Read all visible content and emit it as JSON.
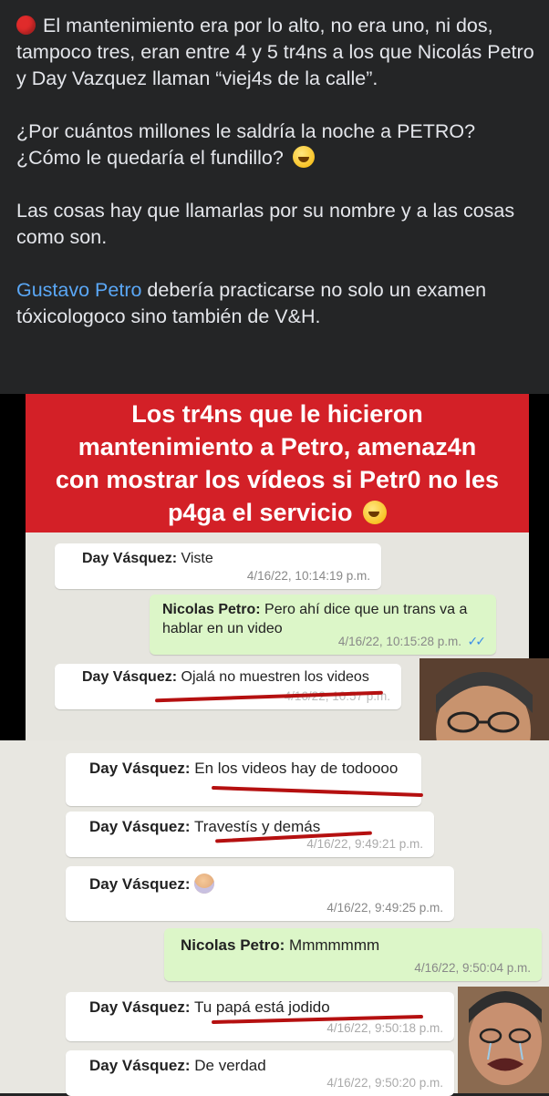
{
  "post": {
    "para1": "El mantenimiento era por lo alto, no era uno, ni dos, tampoco tres, eran entre 4 y 5 tr4ns a los que Nicolás Petro y Day Vazquez llaman “viej4s de la calle”.",
    "para2_line1": "¿Por cuántos millones le saldría la noche a PETRO?",
    "para2_line2": "¿Cómo le quedaría el fundillo?",
    "para3": "Las cosas hay que llamarlas por su nombre y a las cosas como son.",
    "para4_link": "Gustavo Petro",
    "para4_rest": " debería practicarse no solo un examen tóxicologoco sino también de V&H."
  },
  "banner": {
    "line1": "Los tr4ns  que le hicieron",
    "line2": "mantenimiento a Petro, amenaz4n",
    "line3": "con mostrar los vídeos si Petr0 no les",
    "line4": "p4ga el servicio"
  },
  "chat1": [
    {
      "sender": "Day Vásquez:",
      "text": " Viste",
      "time": "4/16/22, 10:14:19 p.m."
    },
    {
      "sender": "Nicolas Petro:",
      "text": "  Pero ahí dice que un trans va a hablar en un video",
      "time": "4/16/22, 10:15:28 p.m."
    },
    {
      "sender": "Day Vásquez:",
      "text": " Ojalá no muestren los videos",
      "time": "4/16/22, 10:57 p.m."
    }
  ],
  "chat2": [
    {
      "sender": "Day Vásquez:",
      "text": " En los videos hay de todoooo",
      "time": ""
    },
    {
      "sender": "Day Vásquez:",
      "text": " Travestís y demás",
      "time": "4/16/22, 9:49:21 p.m."
    },
    {
      "sender": "Day Vásquez:",
      "text": "",
      "time": "4/16/22, 9:49:25 p.m."
    },
    {
      "sender": "Nicolas Petro:",
      "text": " Mmmmmmm",
      "time": "4/16/22, 9:50:04 p.m."
    },
    {
      "sender": "Day Vásquez:",
      "text": " Tu papá está jodido",
      "time": "4/16/22, 9:50:18 p.m."
    },
    {
      "sender": "Day Vásquez:",
      "text": " De verdad",
      "time": "4/16/22, 9:50:20 p.m."
    }
  ],
  "colors": {
    "bg": "#242526",
    "banner": "#d32027",
    "link": "#5aa7f5",
    "underline": "#b51010"
  },
  "icons": [
    "red-circle-icon",
    "rolling-laughing-emoji-icon",
    "facepalm-emoji-icon",
    "double-check-icon"
  ]
}
